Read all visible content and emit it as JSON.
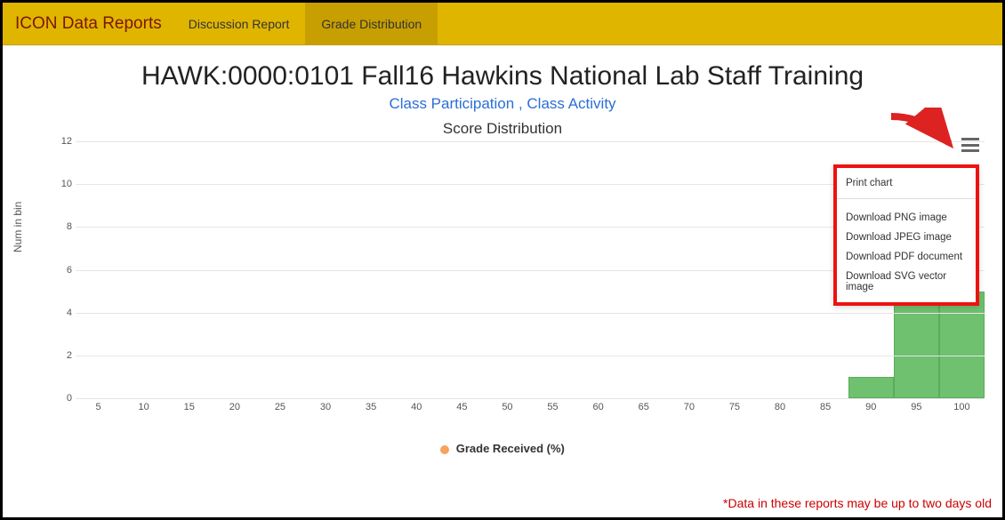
{
  "topbar": {
    "brand": "ICON Data Reports",
    "tabs": [
      {
        "label": "Discussion Report",
        "active": false
      },
      {
        "label": "Grade Distribution",
        "active": true
      }
    ]
  },
  "page": {
    "title": "HAWK:0000:0101 Fall16 Hawkins National Lab Staff Training",
    "subtitle_link1": "Class Participation",
    "subtitle_sep": " , ",
    "subtitle_link2": "Class Activity"
  },
  "chart": {
    "title": "Score Distribution",
    "ylabel": "Num in bin",
    "legend_label": "Grade Received (%)",
    "legend_color": "#f7a35c",
    "ymax": 12,
    "yticks": [
      0,
      2,
      4,
      6,
      8,
      10,
      12
    ],
    "categories": [
      5,
      10,
      15,
      20,
      25,
      30,
      35,
      40,
      45,
      50,
      55,
      60,
      65,
      70,
      75,
      80,
      85,
      90,
      95,
      100
    ],
    "values": [
      0,
      0,
      0,
      0,
      0,
      0,
      0,
      0,
      0,
      0,
      0,
      0,
      0,
      0,
      0,
      0,
      0,
      1,
      5,
      5
    ]
  },
  "chart_data": {
    "type": "bar",
    "title": "Score Distribution",
    "xlabel": "Grade Received (%)",
    "ylabel": "Num in bin",
    "ylim": [
      0,
      12
    ],
    "categories": [
      5,
      10,
      15,
      20,
      25,
      30,
      35,
      40,
      45,
      50,
      55,
      60,
      65,
      70,
      75,
      80,
      85,
      90,
      95,
      100
    ],
    "values": [
      0,
      0,
      0,
      0,
      0,
      0,
      0,
      0,
      0,
      0,
      0,
      0,
      0,
      0,
      0,
      0,
      0,
      1,
      5,
      5
    ]
  },
  "menu": {
    "items": [
      "Print chart",
      "Download PNG image",
      "Download JPEG image",
      "Download PDF document",
      "Download SVG vector image"
    ]
  },
  "footnote": "*Data in these reports may be up to two days old"
}
